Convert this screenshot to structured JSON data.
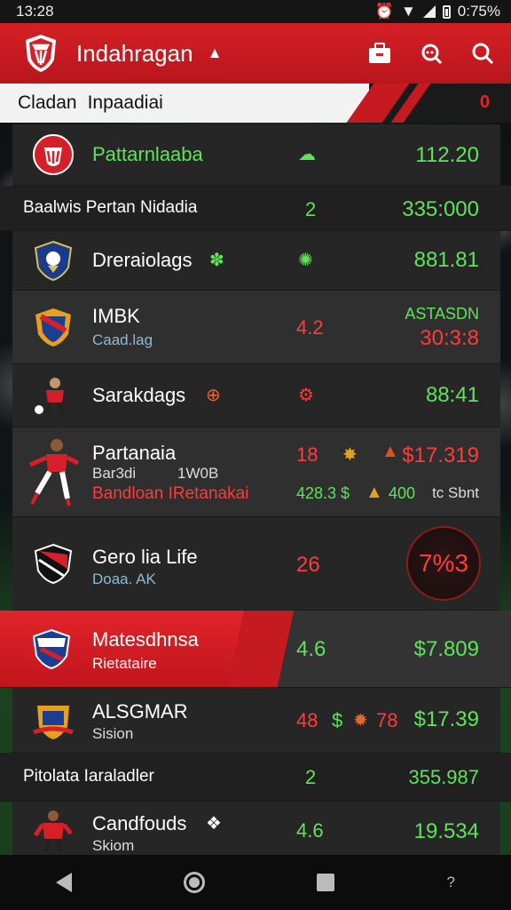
{
  "status_bar": {
    "time": "13:28",
    "battery": "0:75%"
  },
  "app_bar": {
    "title": "Indahragan",
    "caret": "▲"
  },
  "sub_header": {
    "label_1": "Cladan",
    "label_2": "Inpaadiai",
    "icon_glyph": "0"
  },
  "rows": [
    {
      "name": "Pattarnlaaba",
      "mid": "",
      "value": "112.20"
    },
    {
      "section": "Baalwis Pertan Nidadia",
      "mid": "2",
      "value": "335:000"
    },
    {
      "name": "Dreraiolags",
      "value": "881.81"
    },
    {
      "name": "IMBK",
      "sub": "Caad.lag",
      "mid": "4.2",
      "value_top": "ASTASDN",
      "value": "30:3:8"
    },
    {
      "name": "Sarakdags",
      "value": "88:41"
    },
    {
      "name": "Partanaia",
      "sub_a": "Bar3di",
      "sub_b": "1W0B",
      "sub_red": "Bandloan IRetanakai",
      "mid": "18",
      "value": "$17.319",
      "line2_a": "428.3 $",
      "line2_b": "400",
      "line2_c": "tc Sbnt"
    },
    {
      "name": "Gero lia Life",
      "sub": "Doaa. AK",
      "mid": "26",
      "pct": "7%3"
    },
    {
      "name": "Matesdhnsa",
      "sub": "Rietataire",
      "mid": "4.6",
      "value": "$7.809"
    },
    {
      "name": "ALSGMAR",
      "sub": "Sision",
      "mid_a": "48",
      "mid_b": "$",
      "mid_c": "78",
      "value": "$17.39"
    },
    {
      "section": "Pitolata Iaraladler",
      "mid": "2",
      "value": "355.987"
    },
    {
      "name": "Candfouds",
      "sub": "Skiom",
      "mid": "4.6",
      "value": "19.534"
    }
  ],
  "colors": {
    "brand_red": "#d61f26",
    "green": "#5fe35a",
    "red": "#ff3b3b"
  }
}
